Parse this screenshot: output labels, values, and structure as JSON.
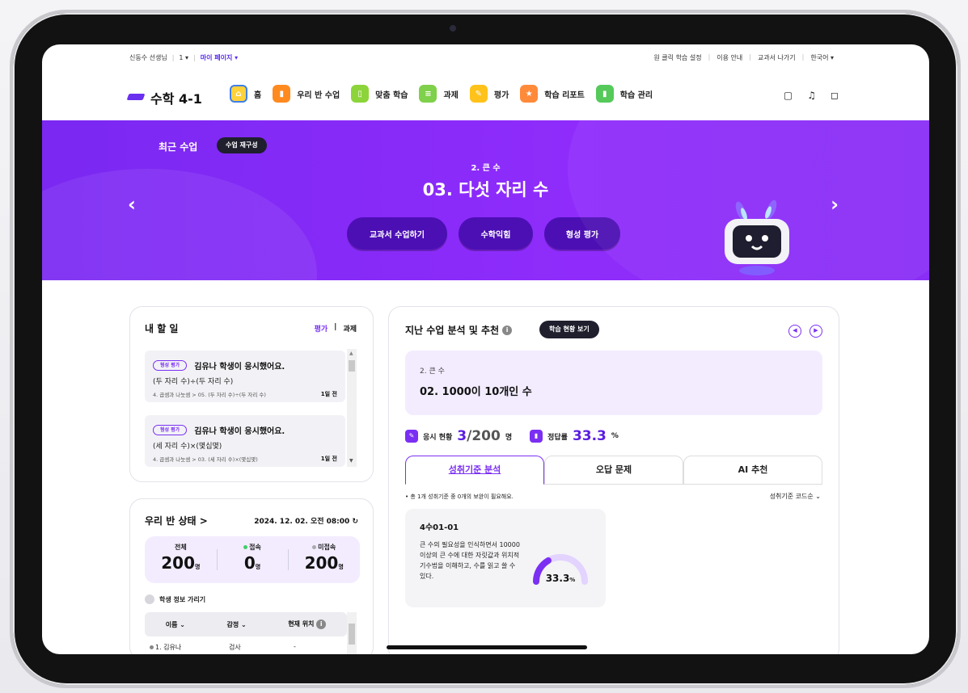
{
  "topbar": {
    "teacher": "신동수 선생님",
    "class_num": "1 ▾",
    "mypage": "마이 페이지 ▾",
    "right_links": [
      "원 클릭 학습 설정",
      "이용 안내",
      "교과서 나가기",
      "한국어 ▾"
    ]
  },
  "nav": {
    "logo": "수학 4-1",
    "items": [
      {
        "label": "홈",
        "icon": "home-icon",
        "color": "#ffd23a"
      },
      {
        "label": "우리 반 수업",
        "icon": "class-icon",
        "color": "#ff8a1f"
      },
      {
        "label": "맞춤 학습",
        "icon": "custom-learning-icon",
        "color": "#8cd43a"
      },
      {
        "label": "과제",
        "icon": "assignment-icon",
        "color": "#7fd04a"
      },
      {
        "label": "평가",
        "icon": "evaluation-icon",
        "color": "#ffc21a"
      },
      {
        "label": "학습 리포트",
        "icon": "report-icon",
        "color": "#ff8a3a"
      },
      {
        "label": "학습 관리",
        "icon": "manage-icon",
        "color": "#55c95a"
      }
    ]
  },
  "banner": {
    "recent_label": "최근 수업",
    "restructure_btn": "수업 재구성",
    "unit": "2. 큰 수",
    "title": "03. 다섯 자리 수",
    "buttons": [
      "교과서 수업하기",
      "수학익힘",
      "형성 평가"
    ]
  },
  "todo": {
    "title": "내 할 일",
    "tab_eval": "평가",
    "tab_sep": "|",
    "tab_assign": "과제",
    "items": [
      {
        "badge": "형성 평가",
        "text": "김유나 학생이 응시했어요.",
        "sub": "(두 자리 수)÷(두 자리 수)",
        "path": "4. 곱셈과 나눗셈 > 05. (두 자리 수)÷(두 자리 수)",
        "when": "1일 전"
      },
      {
        "badge": "형성 평가",
        "text": "김유나 학생이 응시했어요.",
        "sub": "(세 자리 수)×(몇십몇)",
        "path": "4. 곱셈과 나눗셈 > 03. (세 자리 수)×(몇십몇)",
        "when": "1일 전"
      }
    ]
  },
  "class_status": {
    "title": "우리 반 상태 >",
    "timestamp": "2024. 12. 02. 오전 08:00",
    "refresh_icon": "refresh-icon",
    "total_label": "전체",
    "total": "200",
    "online_label": "접속",
    "online": "0",
    "offline_label": "미접속",
    "offline": "200",
    "unit": "명",
    "hide_label": "학생 정보 가리기",
    "headers": [
      "이름 ⌄",
      "감정 ⌄",
      "현재 위치"
    ],
    "rows": [
      {
        "name": "1. 김유나",
        "emotion": "검사",
        "location": "-"
      }
    ]
  },
  "analysis": {
    "title": "지난 수업 분석 및 추천",
    "view_btn": "학습 현황 보기",
    "unit": "2. 큰 수",
    "lesson": "02. 1000이 10개인 수",
    "attempt_label": "응시 현황",
    "attempt": "3",
    "attempt_total": "/200",
    "attempt_unit": "명",
    "accuracy_label": "정답률",
    "accuracy": "33.3",
    "accuracy_unit": "%",
    "tabs": [
      "성취기준 분석",
      "오답 문제",
      "AI 추천"
    ],
    "note": "• 총 1개 성취기준 중 0개의 보완이 필요해요.",
    "sort_label": "성취기준 코드순 ⌄",
    "standard": {
      "code": "4수01-01",
      "desc": "큰 수의 필요성을 인식하면서 10000 이상의 큰 수에 대한 자릿값과 위치적 기수법을 이해하고, 수를 읽고 쓸 수 있다.",
      "percent": "33.3",
      "percent_unit": "%",
      "value": 33.3
    }
  },
  "colors": {
    "brand": "#7b2ff3",
    "banner": "#8a2cf8",
    "dark_btn": "#1f1f2e"
  }
}
